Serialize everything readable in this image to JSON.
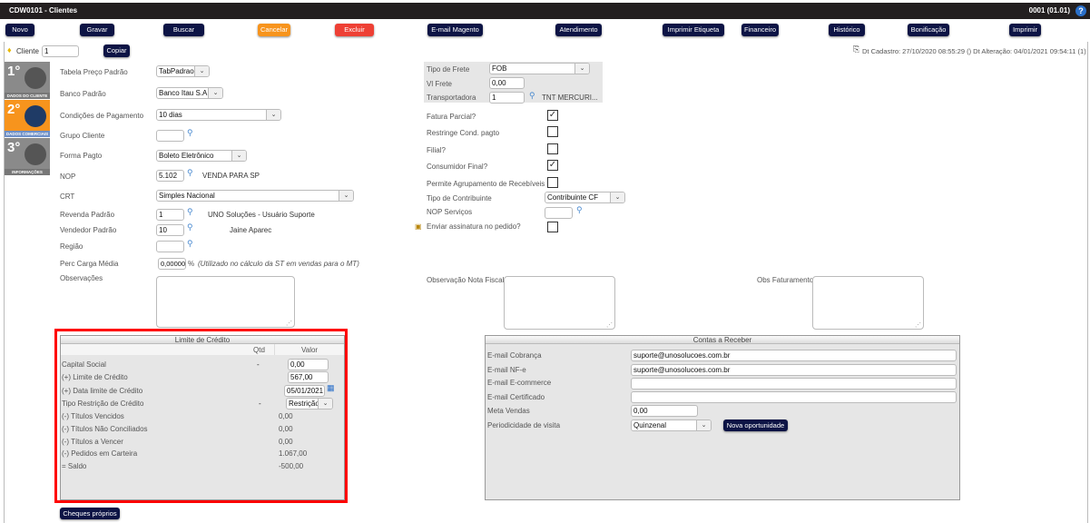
{
  "window": {
    "title": "CDW0101 - Clientes",
    "company": "0001 (01.01)",
    "help": "?"
  },
  "toolbar": {
    "novo": "Novo",
    "gravar": "Gravar",
    "buscar": "Buscar",
    "cancelar": "Cancelar",
    "excluir": "Excluir",
    "email_magento": "E-mail Magento",
    "atendimento": "Atendimento",
    "imprimir_etiqueta": "Imprimir Etiqueta",
    "financeiro": "Financeiro",
    "historico": "Histórico",
    "bonificacao": "Bonificação",
    "imprimir": "Imprimir"
  },
  "colors": {
    "primary_button": "#0d1445",
    "cancel": "#f7941d",
    "delete": "#ee4035",
    "highlight": "#ff0000"
  },
  "cliente": {
    "label": "Cliente",
    "value": "1",
    "copiar": "Copiar"
  },
  "meta": {
    "text": "Dt Cadastro: 27/10/2020 08:55:29 () Dt Alteração: 04/01/2021 09:54:11 (1)"
  },
  "steps": [
    {
      "num": "1°",
      "caption": "DADOS DO CLIENTE"
    },
    {
      "num": "2°",
      "caption": "DADOS COMERCIAIS",
      "active": true
    },
    {
      "num": "3°",
      "caption": "INFORMAÇÕES"
    }
  ],
  "form": {
    "tabela_preco": {
      "label": "Tabela Preço Padrão",
      "value": "TabPadrao"
    },
    "banco": {
      "label": "Banco Padrão",
      "value": "Banco Itau S.A."
    },
    "cond_pagto": {
      "label": "Condições de Pagamento",
      "value": "10 dias"
    },
    "grupo": {
      "label": "Grupo Cliente",
      "value": ""
    },
    "forma_pagto": {
      "label": "Forma Pagto",
      "value": "Boleto Eletrônico"
    },
    "nop": {
      "label": "NOP",
      "value": "5.102",
      "desc": "VENDA PARA SP"
    },
    "crt": {
      "label": "CRT",
      "value": "Simples Nacional"
    },
    "revenda": {
      "label": "Revenda Padrão",
      "value": "1",
      "desc": "UNO Soluções - Usuário Suporte"
    },
    "vendedor": {
      "label": "Vendedor Padrão",
      "value": "10",
      "desc": "Jaine Aparec"
    },
    "regiao": {
      "label": "Região",
      "value": ""
    },
    "carga": {
      "label": "Perc Carga Média",
      "value": "0,00000",
      "unit": "%",
      "note": "(Utilizado no cálculo da ST em vendas para o MT)"
    },
    "obs": {
      "label": "Observações"
    }
  },
  "right": {
    "tipo_frete": {
      "label": "Tipo de Frete",
      "value": "FOB"
    },
    "vl_frete": {
      "label": "Vl Frete",
      "value": "0,00"
    },
    "transportadora": {
      "label": "Transportadora",
      "value": "1",
      "desc": "TNT MERCURI..."
    },
    "fatura_parcial": {
      "label": "Fatura Parcial?",
      "checked": true
    },
    "restringe": {
      "label": "Restringe Cond. pagto",
      "checked": false
    },
    "filial": {
      "label": "Filial?",
      "checked": false
    },
    "consumidor": {
      "label": "Consumidor Final?",
      "checked": true
    },
    "agrupamento": {
      "label": "Permite Agrupamento de Recebíveis",
      "checked": false
    },
    "tipo_contrib": {
      "label": "Tipo de Contribuinte",
      "value": "Contribuinte CF"
    },
    "nop_serv": {
      "label": "NOP Serviços",
      "value": ""
    },
    "assinatura": {
      "label": "Enviar assinatura no pedido?",
      "checked": false
    },
    "obs_nf": {
      "label": "Observação Nota Fiscal"
    },
    "obs_fat": {
      "label": "Obs Faturamento"
    }
  },
  "limite": {
    "title": "Limite de Crédito",
    "col_qtd": "Qtd",
    "col_valor": "Valor",
    "capital": {
      "label": "Capital Social",
      "qtd": "-",
      "value": "0,00"
    },
    "limite": {
      "label": "(+) Limite de Crédito",
      "value": "567,00"
    },
    "data": {
      "label": "(+) Data limite de Crédito",
      "value": "05/01/2021"
    },
    "tipo": {
      "label": "Tipo Restrição de Crédito",
      "qtd": "-",
      "value": "Restrição"
    },
    "rows": [
      {
        "label": "(-) Títulos Vencidos",
        "value": "0,00"
      },
      {
        "label": "(-) Títulos Não Conciliados",
        "value": "0,00"
      },
      {
        "label": "(-) Títulos a Vencer",
        "value": "0,00"
      },
      {
        "label": "(-) Pedidos em Carteira",
        "value": "1.067,00"
      },
      {
        "label": "= Saldo",
        "value": "-500,00"
      }
    ],
    "cheques": "Cheques próprios"
  },
  "contas": {
    "title": "Contas a Receber",
    "cobranca": {
      "label": "E-mail Cobrança",
      "value": "suporte@unosolucoes.com.br"
    },
    "nfe": {
      "label": "E-mail NF-e",
      "value": "suporte@unosolucoes.com.br"
    },
    "ecommerce": {
      "label": "E-mail E-commerce",
      "value": ""
    },
    "certificado": {
      "label": "E-mail Certificado",
      "value": ""
    },
    "meta": {
      "label": "Meta Vendas",
      "value": "0,00"
    },
    "periodicidade": {
      "label": "Periodicidade de visita",
      "value": "Quinzenal"
    },
    "nova": "Nova oportunidade"
  }
}
